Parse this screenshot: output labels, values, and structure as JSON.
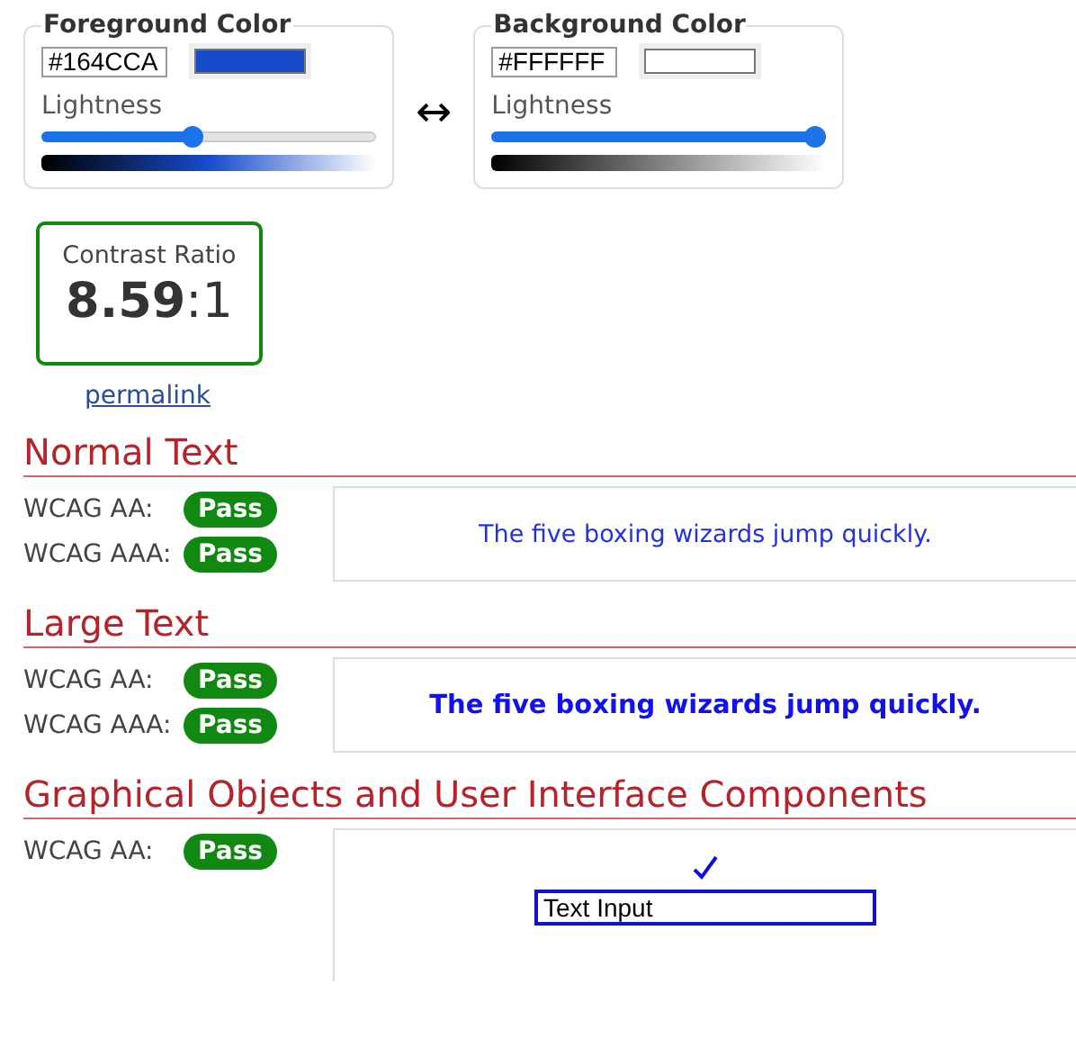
{
  "colors": [
    {
      "legend": "Foreground Color",
      "hex": "#164CCA",
      "lightness_label": "Lightness",
      "level": 0.45
    },
    {
      "legend": "Background Color",
      "hex": "#FFFFFF",
      "lightness_label": "Lightness",
      "level": 1
    }
  ],
  "swap": "↔",
  "contrast": {
    "label": "Contrast Ratio",
    "value": "**8.59**:1"
  },
  "permalink": "permalink",
  "sections": [
    {
      "kind": "normal",
      "title": "Normal Text",
      "results": [
        {
          "label": "WCAG AA:",
          "result": "Pass"
        },
        {
          "label": "WCAG AAA:",
          "result": "Pass"
        }
      ],
      "sample": "The five boxing wizards jump quickly."
    },
    {
      "kind": "large",
      "title": "Large Text",
      "results": [
        {
          "label": "WCAG AA:",
          "result": "Pass"
        },
        {
          "label": "WCAG AAA:",
          "result": "Pass"
        }
      ],
      "sample": "The five boxing wizards jump quickly."
    },
    {
      "kind": "graphical",
      "title": "Graphical Objects and User Interface Components",
      "results": [
        {
          "label": "WCAG AA:",
          "result": "Pass"
        }
      ],
      "sample": "Text Input"
    }
  ]
}
